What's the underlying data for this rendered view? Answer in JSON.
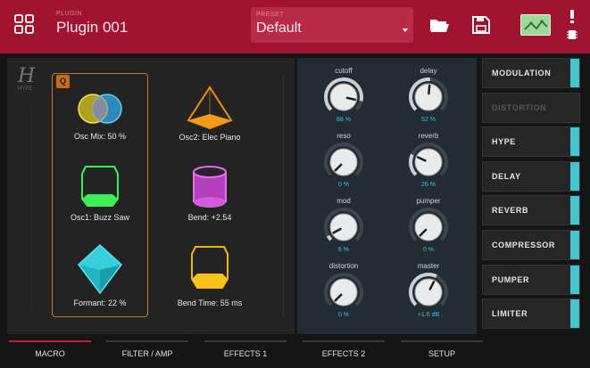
{
  "header": {
    "plugin_caption": "Plugin",
    "plugin_name": "Plugin 001",
    "preset_caption": "Preset",
    "preset_value": "Default",
    "icons": [
      "grid-icon",
      "folder-icon",
      "save-icon",
      "waveform-icon",
      "warning-icon",
      "chip-icon"
    ]
  },
  "left_panel": {
    "badge": "Q",
    "logo": "H",
    "logo_sub": "HYPE",
    "macros": [
      {
        "label": "Osc Mix: 50 %",
        "icon": "venn-circles-icon"
      },
      {
        "label": "Osc2: Elec Piano",
        "icon": "pyramid-icon"
      },
      {
        "label": "Osc1: Buzz Saw",
        "icon": "green-prism-icon"
      },
      {
        "label": "Bend: +2.54",
        "icon": "cylinder-icon"
      },
      {
        "label": "Formant: 22 %",
        "icon": "diamond-icon"
      },
      {
        "label": "Bend Time: 55 ms",
        "icon": "yellow-prism-icon"
      }
    ]
  },
  "knobs": [
    {
      "name": "cutoff",
      "value": "88 %",
      "level": 0.88
    },
    {
      "name": "delay",
      "value": "52 %",
      "level": 0.52
    },
    {
      "name": "reso",
      "value": "0 %",
      "level": 0.0
    },
    {
      "name": "reverb",
      "value": "26 %",
      "level": 0.26
    },
    {
      "name": "mod",
      "value": "6 %",
      "level": 0.06
    },
    {
      "name": "pumper",
      "value": "0 %",
      "level": 0.0
    },
    {
      "name": "distortion",
      "value": "0 %",
      "level": 0.0
    },
    {
      "name": "master",
      "value": "+1.6 dB",
      "level": 0.6
    }
  ],
  "effects": [
    {
      "label": "MODULATION",
      "enabled": true
    },
    {
      "label": "DISTORTION",
      "enabled": false
    },
    {
      "label": "HYPE",
      "enabled": true
    },
    {
      "label": "DELAY",
      "enabled": true
    },
    {
      "label": "REVERB",
      "enabled": true
    },
    {
      "label": "COMPRESSOR",
      "enabled": true
    },
    {
      "label": "PUMPER",
      "enabled": true
    },
    {
      "label": "LIMITER",
      "enabled": true
    }
  ],
  "tabs": [
    {
      "label": "MACRO",
      "active": true
    },
    {
      "label": "FILTER / AMP",
      "active": false
    },
    {
      "label": "EFFECTS 1",
      "active": false
    },
    {
      "label": "EFFECTS 2",
      "active": false
    },
    {
      "label": "SETUP",
      "active": false
    }
  ],
  "colors": {
    "header": "#a0142f",
    "accent_cyan": "#3ec7d3",
    "macro_frame": "#c27a2e",
    "active_tab": "#c52042"
  }
}
